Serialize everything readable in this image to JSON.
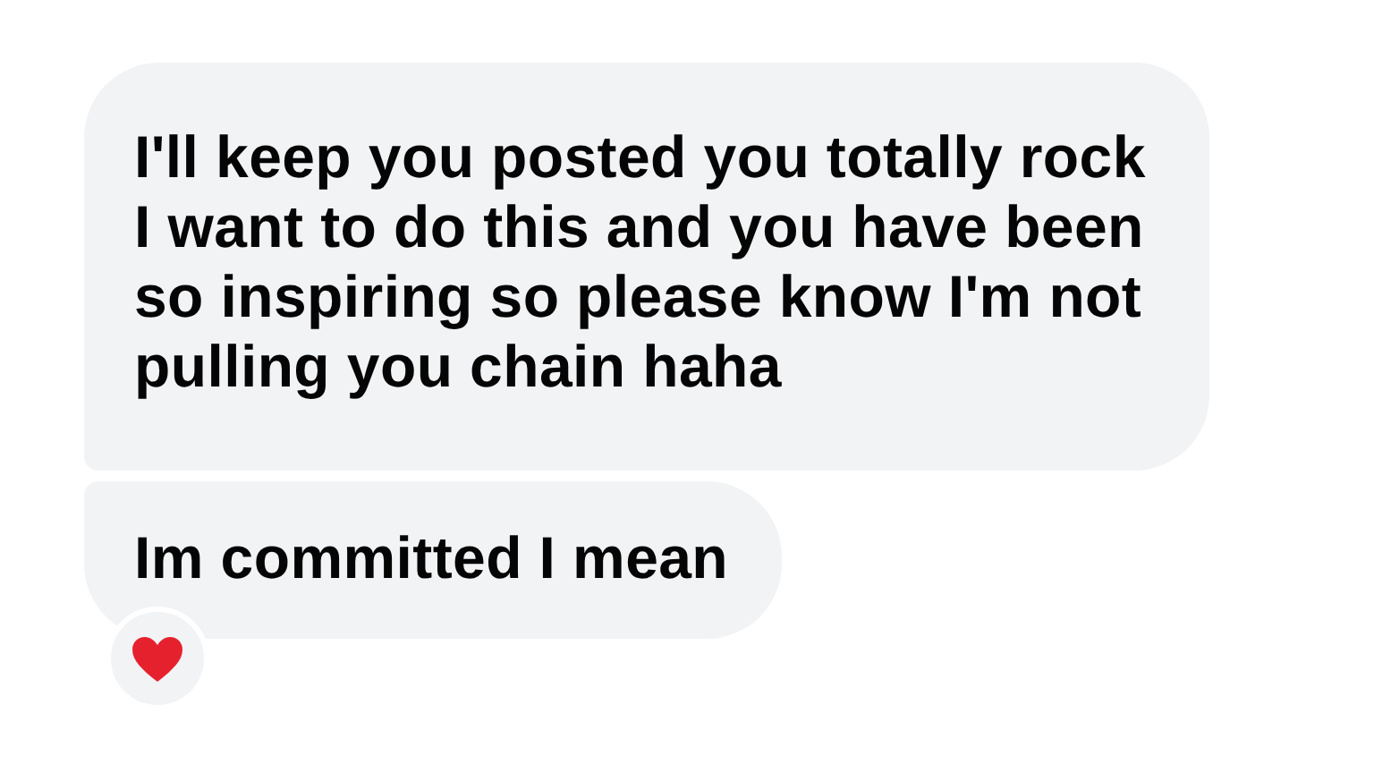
{
  "messages": [
    {
      "text": "I'll keep you posted you totally rock\nI want to do this and you have been\nso inspiring so please know I'm not\npulling you chain haha",
      "kind": "first",
      "reacted": false
    },
    {
      "text": "Im committed I mean",
      "kind": "last",
      "reacted": true
    }
  ]
}
